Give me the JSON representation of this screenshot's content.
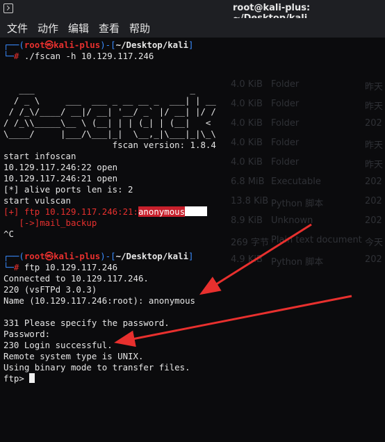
{
  "window": {
    "title": "root@kali-plus: ~/Desktop/kali"
  },
  "menu": {
    "items": [
      "文件",
      "动作",
      "编辑",
      "查看",
      "帮助"
    ]
  },
  "prompt1": {
    "open": "┌──(",
    "user": "root㉿kali-plus",
    "mid": ")-[",
    "path": "~/Desktop/kali",
    "close": "]",
    "corner": "└─",
    "hash": "#",
    "command": "./fscan -h 10.129.117.246"
  },
  "banner": [
    "   ___                              _",
    "  / _ \\     ___  ___ _ __ __ _  ___| | __",
    " / /_\\/____/ __|/ __| '__/ _` |/ __| |/ /",
    "/ /_\\\\_____\\__ \\ (__| | | (_| | (__|   <",
    "\\____/     |___/\\___|_|  \\__,_|\\___|_|\\_\\",
    "                     fscan version: 1.8.4"
  ],
  "scan_output": [
    "start infoscan",
    "10.129.117.246:22 open",
    "10.129.117.246:21 open",
    "[*] alive ports len is: 2",
    "start vulscan"
  ],
  "vuln": {
    "text": "[+] ftp 10.129.117.246:21:",
    "highlight": "anonymous",
    "sub": "   [->]mail_backup"
  },
  "interrupt": "^C",
  "prompt2": {
    "open": "┌──(",
    "user": "root㉿kali-plus",
    "mid": ")-[",
    "path": "~/Desktop/kali",
    "close": "]",
    "corner": "└─",
    "hash": "#",
    "command": "ftp 10.129.117.246"
  },
  "ftp_output": [
    "Connected to 10.129.117.246.",
    "220 (vsFTPd 3.0.3)",
    "Name (10.129.117.246:root): anonymous",
    "",
    "331 Please specify the password.",
    "Password:",
    "230 Login successful.",
    "Remote system type is UNIX.",
    "Using binary mode to transfer files."
  ],
  "ftp_prompt": "ftp>",
  "ghost_rows": [
    {
      "size": "4.0 KiB",
      "type": "Folder",
      "date": "昨天"
    },
    {
      "size": "4.0 KiB",
      "type": "Folder",
      "date": "昨天"
    },
    {
      "size": "4.0 KiB",
      "type": "Folder",
      "date": "202"
    },
    {
      "size": "4.0 KiB",
      "type": "Folder",
      "date": "昨天"
    },
    {
      "size": "4.0 KiB",
      "type": "Folder",
      "date": "昨天"
    },
    {
      "size": "6.8 MiB",
      "type": "Executable",
      "date": "202"
    },
    {
      "size": "13.8 KiB",
      "type": "Python 脚本",
      "date": "202"
    },
    {
      "size": "8.9 KiB",
      "type": "Unknown",
      "date": "202"
    },
    {
      "size": "269 字节",
      "type": "Plain text document",
      "date": "今天"
    },
    {
      "size": "4.9 KiB",
      "type": "Python 脚本",
      "date": "202"
    }
  ],
  "colors": {
    "prompt": "#3a8cff",
    "user": "#e8302e",
    "highlight": "#c8202c",
    "arrow": "#e8302e"
  }
}
